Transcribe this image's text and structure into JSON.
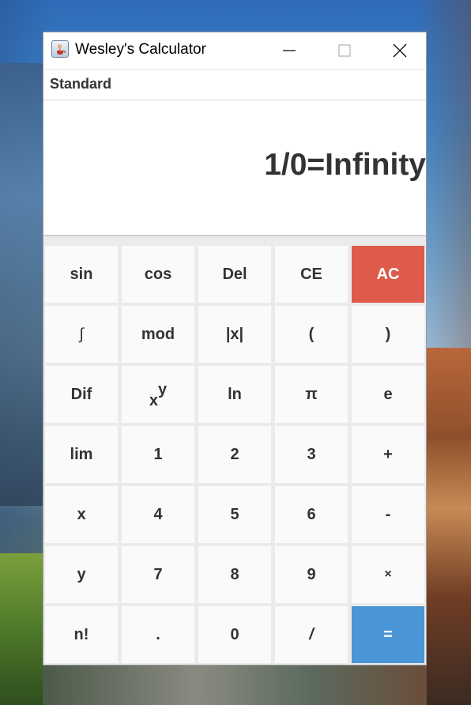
{
  "window": {
    "title": "Wesley's Calculator",
    "icon": "java-cup-icon",
    "controls": [
      "minimize-icon",
      "maximize-icon",
      "close-icon"
    ]
  },
  "mode": {
    "label": "Standard"
  },
  "display": {
    "text": "1/0=Infinity"
  },
  "keys": {
    "sin": "sin",
    "cos": "cos",
    "del": "Del",
    "ce": "CE",
    "ac": "AC",
    "integral": "∫",
    "mod": "mod",
    "abs": "|x|",
    "lparen": "(",
    "rparen": ")",
    "dif": "Dif",
    "pow_base": "x",
    "pow_exp": "y",
    "ln": "ln",
    "pi": "π",
    "e": "e",
    "lim": "lim",
    "d1": "1",
    "d2": "2",
    "d3": "3",
    "plus": "+",
    "x": "x",
    "d4": "4",
    "d5": "5",
    "d6": "6",
    "minus": "-",
    "y": "y",
    "d7": "7",
    "d8": "8",
    "d9": "9",
    "times": "×",
    "fact": "n!",
    "dot": ".",
    "d0": "0",
    "divide": "/",
    "equals": "="
  },
  "colors": {
    "ac": "#de5b4c",
    "equals": "#4a95d6"
  }
}
